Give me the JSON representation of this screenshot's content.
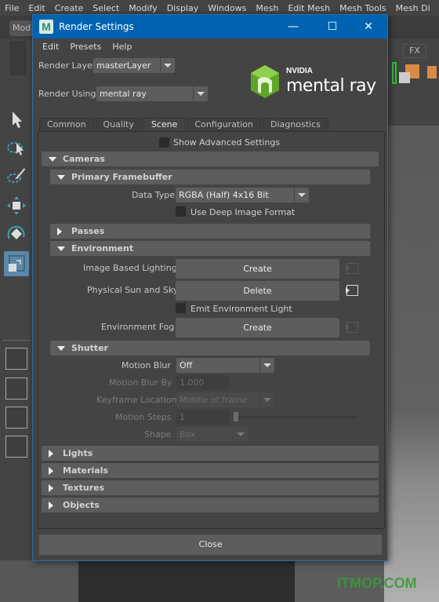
{
  "app_menu": [
    "File",
    "Edit",
    "Create",
    "Select",
    "Modify",
    "Display",
    "Windows",
    "Mesh",
    "Edit Mesh",
    "Mesh Tools",
    "Mesh Di"
  ],
  "mode_selector": "Mod",
  "shelf_tab": "FX",
  "watermark": "ITMOP.COM",
  "dialog": {
    "title": "Render Settings",
    "app_icon_letter": "M",
    "window_buttons": {
      "minimize": "—",
      "maximize": "☐",
      "close": "✕"
    },
    "menu": [
      "Edit",
      "Presets",
      "Help"
    ],
    "render_layer": {
      "label": "Render Layer",
      "value": "masterLayer"
    },
    "render_using": {
      "label": "Render Using",
      "value": "mental ray"
    },
    "logo": {
      "brand": "NVIDIA",
      "product": "mental ray",
      "brand_color": "#76b900"
    },
    "tabs": [
      {
        "label": "Common",
        "active": false
      },
      {
        "label": "Quality",
        "active": false
      },
      {
        "label": "Scene",
        "active": true
      },
      {
        "label": "Configuration",
        "active": false
      },
      {
        "label": "Diagnostics",
        "active": false
      }
    ],
    "show_advanced": {
      "label": "Show Advanced Settings",
      "checked": false
    },
    "sections": {
      "cameras": {
        "label": "Cameras",
        "expanded": true
      },
      "primary_framebuffer": {
        "label": "Primary Framebuffer",
        "expanded": true
      },
      "passes": {
        "label": "Passes",
        "expanded": false
      },
      "environment": {
        "label": "Environment",
        "expanded": true
      },
      "shutter": {
        "label": "Shutter",
        "expanded": true
      },
      "lights": {
        "label": "Lights",
        "expanded": false
      },
      "materials": {
        "label": "Materials",
        "expanded": false
      },
      "textures": {
        "label": "Textures",
        "expanded": false
      },
      "objects": {
        "label": "Objects",
        "expanded": false
      }
    },
    "framebuffer": {
      "data_type_label": "Data Type",
      "data_type_value": "RGBA (Half)  4x16 Bit",
      "deep_image": {
        "label": "Use Deep Image Format",
        "checked": false
      }
    },
    "environment": {
      "ibl": {
        "label": "Image Based Lighting",
        "button": "Create"
      },
      "sun_sky": {
        "label": "Physical Sun and Sky",
        "button": "Delete"
      },
      "emit_light": {
        "label": "Emit Environment Light",
        "checked": false
      },
      "fog": {
        "label": "Environment Fog",
        "button": "Create"
      }
    },
    "shutter": {
      "motion_blur": {
        "label": "Motion Blur",
        "value": "Off"
      },
      "motion_blur_by": {
        "label": "Motion Blur By",
        "value": "1.000"
      },
      "keyframe_location": {
        "label": "Keyframe Location",
        "value": "Middle of frame"
      },
      "motion_steps": {
        "label": "Motion Steps",
        "value": "1"
      },
      "shape": {
        "label": "Shape",
        "value": "Box"
      }
    },
    "close_button": "Close"
  }
}
